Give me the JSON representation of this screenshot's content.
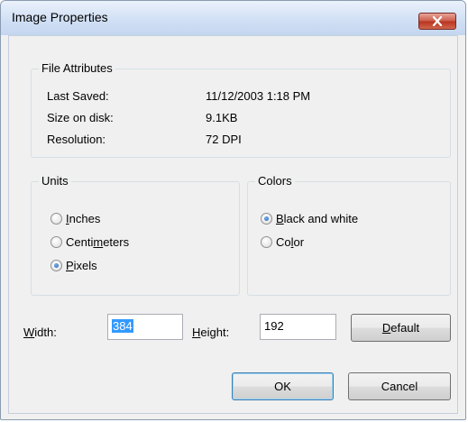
{
  "window": {
    "title": "Image Properties"
  },
  "file_attributes": {
    "legend": "File Attributes",
    "rows": [
      {
        "label": "Last Saved:",
        "value": "11/12/2003 1:18 PM"
      },
      {
        "label": "Size on disk:",
        "value": "9.1KB"
      },
      {
        "label": "Resolution:",
        "value": "72 DPI"
      }
    ]
  },
  "units": {
    "legend": "Units",
    "options": [
      {
        "pre": "",
        "mnemonic": "I",
        "post": "nches",
        "checked": false
      },
      {
        "pre": "Centi",
        "mnemonic": "m",
        "post": "eters",
        "checked": false
      },
      {
        "pre": "",
        "mnemonic": "P",
        "post": "ixels",
        "checked": true
      }
    ]
  },
  "colors": {
    "legend": "Colors",
    "options": [
      {
        "pre": "",
        "mnemonic": "B",
        "post": "lack and white",
        "checked": true
      },
      {
        "pre": "Co",
        "mnemonic": "l",
        "post": "or",
        "checked": false
      }
    ]
  },
  "size": {
    "width": {
      "mnemonic": "W",
      "rest": "idth:",
      "value": "384"
    },
    "height": {
      "mnemonic": "H",
      "rest": "eight:",
      "value": "192"
    }
  },
  "buttons": {
    "default": {
      "mnemonic": "D",
      "rest": "efault"
    },
    "ok": "OK",
    "cancel": "Cancel"
  },
  "icons": {
    "close": "close-icon",
    "radio": "radio-button-icon"
  },
  "colors_ui": {
    "selection": "#3399ff",
    "close_button": "#c9503c",
    "title_bar": "#cfdff4"
  }
}
